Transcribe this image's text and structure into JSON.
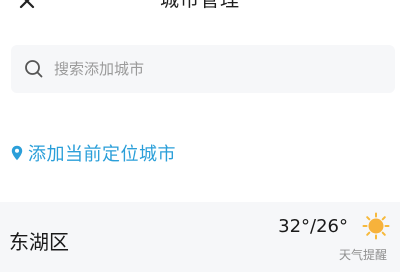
{
  "header": {
    "title": "城市管理",
    "close_icon": "close-icon"
  },
  "search": {
    "placeholder": "搜索添加城市",
    "value": "",
    "icon": "search-icon"
  },
  "locate": {
    "label": "添加当前定位城市",
    "icon": "location-pin-icon",
    "color": "#2b9fd9"
  },
  "cities": [
    {
      "name": "东湖区",
      "temperature": "32°/26°",
      "weather_icon": "sun-icon",
      "alert_label": "天气提醒"
    }
  ]
}
